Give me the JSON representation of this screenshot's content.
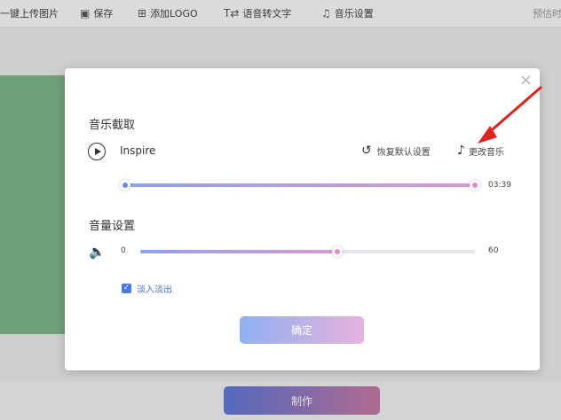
{
  "toolbar": {
    "items": [
      {
        "label": "一键上传图片",
        "icon": ""
      },
      {
        "label": "保存",
        "icon": "save-icon"
      },
      {
        "label": "添加LOGO",
        "icon": "add-icon"
      },
      {
        "label": "语音转文字",
        "icon": "speech-to-text-icon"
      },
      {
        "label": "音乐设置",
        "icon": "music-icon"
      }
    ],
    "right_label": "预估时"
  },
  "bottom": {
    "make_label": "制作"
  },
  "modal": {
    "close_label": "×",
    "music_section": "音乐截取",
    "song_name": "Inspire",
    "restore_label": "恢复默认设置",
    "change_music_label": "更改音乐",
    "duration": "03:39",
    "volume_section": "音量设置",
    "volume_min": "0",
    "volume_max": "60",
    "volume_level": 0.59,
    "fade_label": "淡入淡出",
    "fade_checked": true,
    "confirm_label": "确定"
  },
  "colors": {
    "accent_blue": "#8fa2ef",
    "accent_pink": "#d89ad0",
    "arrow_red": "#e0231a",
    "highlight_green": "#7fb889"
  }
}
